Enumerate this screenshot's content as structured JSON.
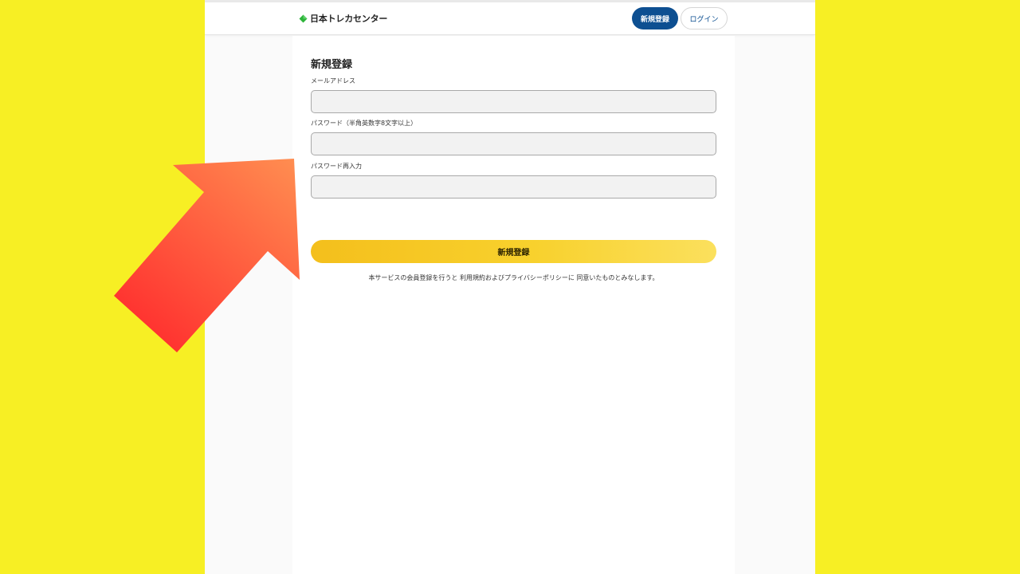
{
  "header": {
    "logo_text": "日本トレカセンター",
    "register_label": "新規登録",
    "login_label": "ログイン"
  },
  "form": {
    "title": "新規登録",
    "email_label": "メールアドレス",
    "email_value": "",
    "password_label": "パスワード（半角英数字8文字以上）",
    "password_value": "",
    "password_confirm_label": "パスワード再入力",
    "password_confirm_value": "",
    "submit_label": "新規登録",
    "agreement_text": "本サービスの会員登録を行うと 利用規約およびプライバシーポリシーに 同意いたものとみなします。"
  },
  "colors": {
    "background": "#f7ef24",
    "brand_blue": "#0d4f91",
    "submit_yellow": "#f8d12d",
    "arrow_top": "#ff8c50",
    "arrow_bottom": "#ff2e2e",
    "logo_green": "#2db43a"
  },
  "icons": {
    "logo": "green-diamond-icon",
    "overlay": "pointing-arrow-icon"
  }
}
